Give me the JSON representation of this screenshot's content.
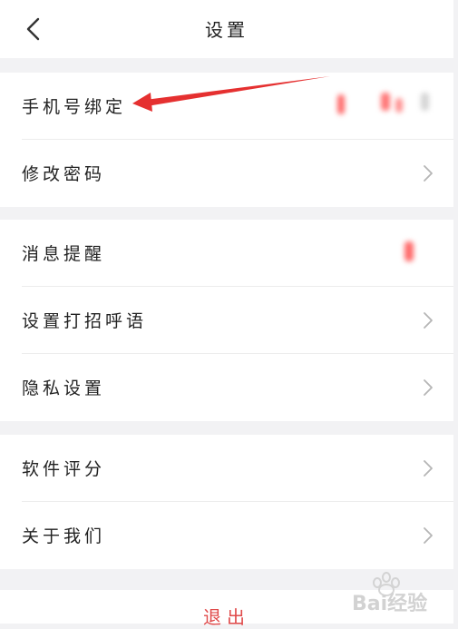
{
  "header": {
    "title": "设置",
    "back_icon": "chevron-left-icon"
  },
  "groups": [
    {
      "items": [
        {
          "label": "手机号绑定",
          "value_hidden": true
        },
        {
          "label": "修改密码",
          "chevron": true
        }
      ]
    },
    {
      "items": [
        {
          "label": "消息提醒",
          "value_hidden": true
        },
        {
          "label": "设置打招呼语",
          "chevron": true
        },
        {
          "label": "隐私设置",
          "chevron": true
        }
      ]
    },
    {
      "items": [
        {
          "label": "软件评分",
          "chevron": true
        },
        {
          "label": "关于我们",
          "chevron": true
        }
      ]
    }
  ],
  "logout": {
    "label": "退出"
  },
  "colors": {
    "accent_red": "#e04a4a",
    "arrow_red": "#e53030",
    "background": "#f2f2f4"
  },
  "watermark": {
    "text": "Bai经验"
  }
}
